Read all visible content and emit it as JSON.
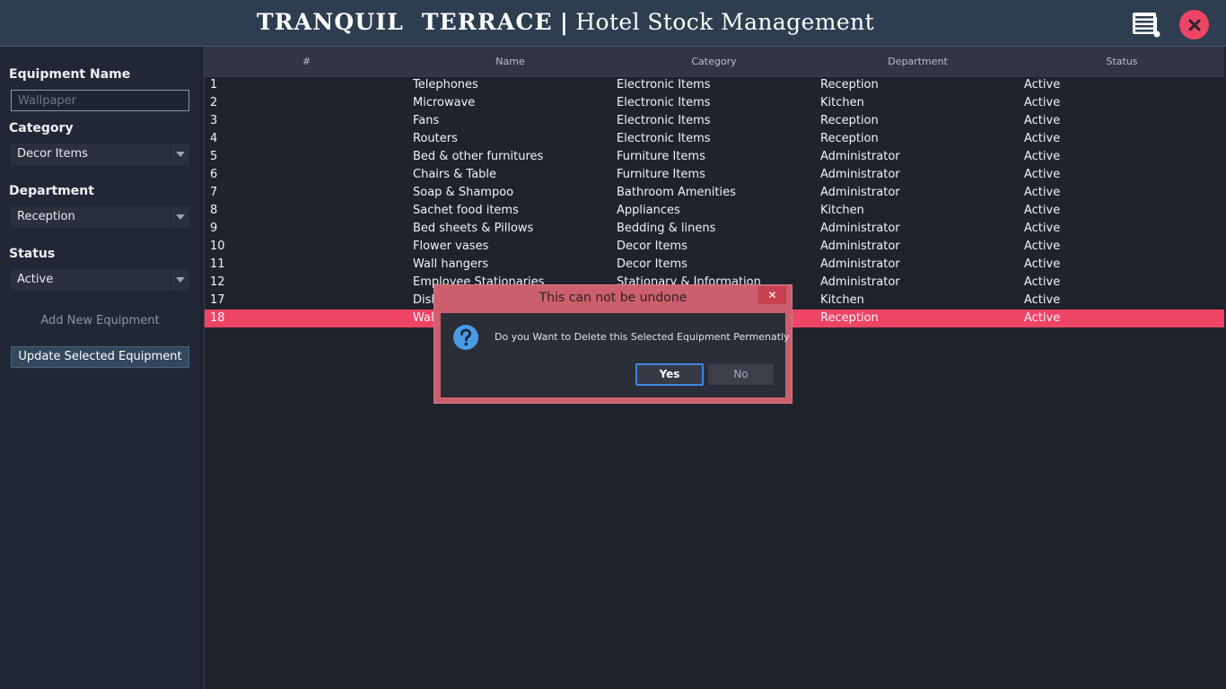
{
  "header": {
    "brand": "TRANQUIL  TERRACE",
    "separator": "|",
    "subtitle": "Hotel Stock Management",
    "menu_icon": "document-list-icon",
    "close_icon": "close-icon",
    "accent_color": "#ee4466"
  },
  "form": {
    "equipment_name_label": "Equipment Name",
    "equipment_name_placeholder": "Wallpaper",
    "equipment_name_value": "",
    "category_label": "Category",
    "category_value": "Decor Items",
    "department_label": "Department",
    "department_value": "Reception",
    "status_label": "Status",
    "status_value": "Active",
    "add_button": "Add New Equipment",
    "update_button": "Update Selected Equipment"
  },
  "table": {
    "columns": [
      "#",
      "Name",
      "Category",
      "Department",
      "Status"
    ],
    "rows": [
      [
        "1",
        "Telephones",
        "Electronic Items",
        "Reception",
        "Active"
      ],
      [
        "2",
        "Microwave",
        "Electronic Items",
        "Kitchen",
        "Active"
      ],
      [
        "3",
        "Fans",
        "Electronic Items",
        "Reception",
        "Active"
      ],
      [
        "4",
        "Routers",
        "Electronic Items",
        "Reception",
        "Active"
      ],
      [
        "5",
        "Bed & other furnitures",
        "Furniture Items",
        "Administrator",
        "Active"
      ],
      [
        "6",
        "Chairs & Table",
        "Furniture Items",
        "Administrator",
        "Active"
      ],
      [
        "7",
        "Soap & Shampoo",
        "Bathroom Amenities",
        "Administrator",
        "Active"
      ],
      [
        "8",
        "Sachet food items",
        "Appliances",
        "Kitchen",
        "Active"
      ],
      [
        "9",
        "Bed sheets & Pillows",
        "Bedding & linens",
        "Administrator",
        "Active"
      ],
      [
        "10",
        "Flower vases",
        "Decor Items",
        "Administrator",
        "Active"
      ],
      [
        "11",
        "Wall hangers",
        "Decor Items",
        "Administrator",
        "Active"
      ],
      [
        "12",
        "Employee Stationaries",
        "Stationary & Information",
        "Administrator",
        "Active"
      ],
      [
        "17",
        "Dish",
        "",
        "Kitchen",
        "Active"
      ],
      [
        "18",
        "Wal",
        "",
        "Reception",
        "Active"
      ]
    ],
    "selected_row_color": "#ee4466"
  },
  "dialog": {
    "title": "This can not be undone",
    "close_label": "✕",
    "icon": "question-icon",
    "message": "Do you Want to Delete this Selected Equipment Permenatly",
    "yes_label": "Yes",
    "no_label": "No"
  }
}
